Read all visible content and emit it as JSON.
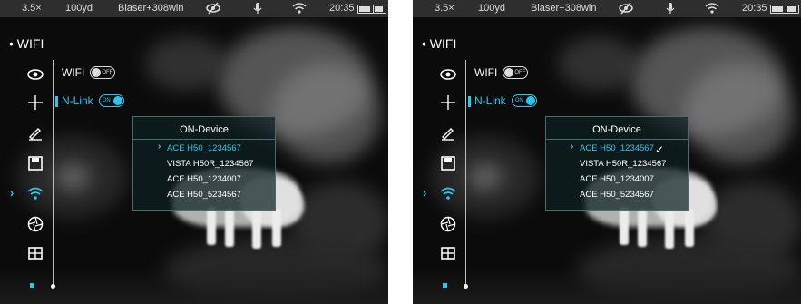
{
  "screens": [
    {
      "status": {
        "zoom": "3.5×",
        "distance": "100yd",
        "profile": "Blaser+308win",
        "time": "20:35"
      },
      "menu": {
        "title": "• WIFI"
      },
      "settings": {
        "wifi_label": "WIFI",
        "wifi_toggle": "OFF",
        "nlink_label": "N-Link",
        "nlink_toggle": "ON"
      },
      "panel": {
        "title": "ON-Device",
        "devices": [
          "ACE H50_1234567",
          "VISTA H50R_1234567",
          "ACE H50_1234007",
          "ACE H50_5234567"
        ],
        "selected_index": 0,
        "connected": false
      }
    },
    {
      "status": {
        "zoom": "3.5×",
        "distance": "100yd",
        "profile": "Blaser+308win",
        "time": "20:35"
      },
      "menu": {
        "title": "• WIFI"
      },
      "settings": {
        "wifi_label": "WIFI",
        "wifi_toggle": "OFF",
        "nlink_label": "N-Link",
        "nlink_toggle": "ON"
      },
      "panel": {
        "title": "ON-Device",
        "devices": [
          "ACE H50_1234567",
          "VISTA H50R_1234567",
          "ACE H50_1234007",
          "ACE H50_5234567"
        ],
        "selected_index": 0,
        "connected": true,
        "check_mark": "✓"
      }
    }
  ],
  "menu_icons": [
    "eye-icon",
    "crosshair-icon",
    "pen-icon",
    "save-icon",
    "wifi-icon",
    "aperture-icon",
    "grid-icon"
  ],
  "active_menu_icon": "wifi-icon",
  "colors": {
    "accent": "#27c8ee",
    "status_bar": "#2e2e2e",
    "panel_bg": "#0e2022"
  }
}
